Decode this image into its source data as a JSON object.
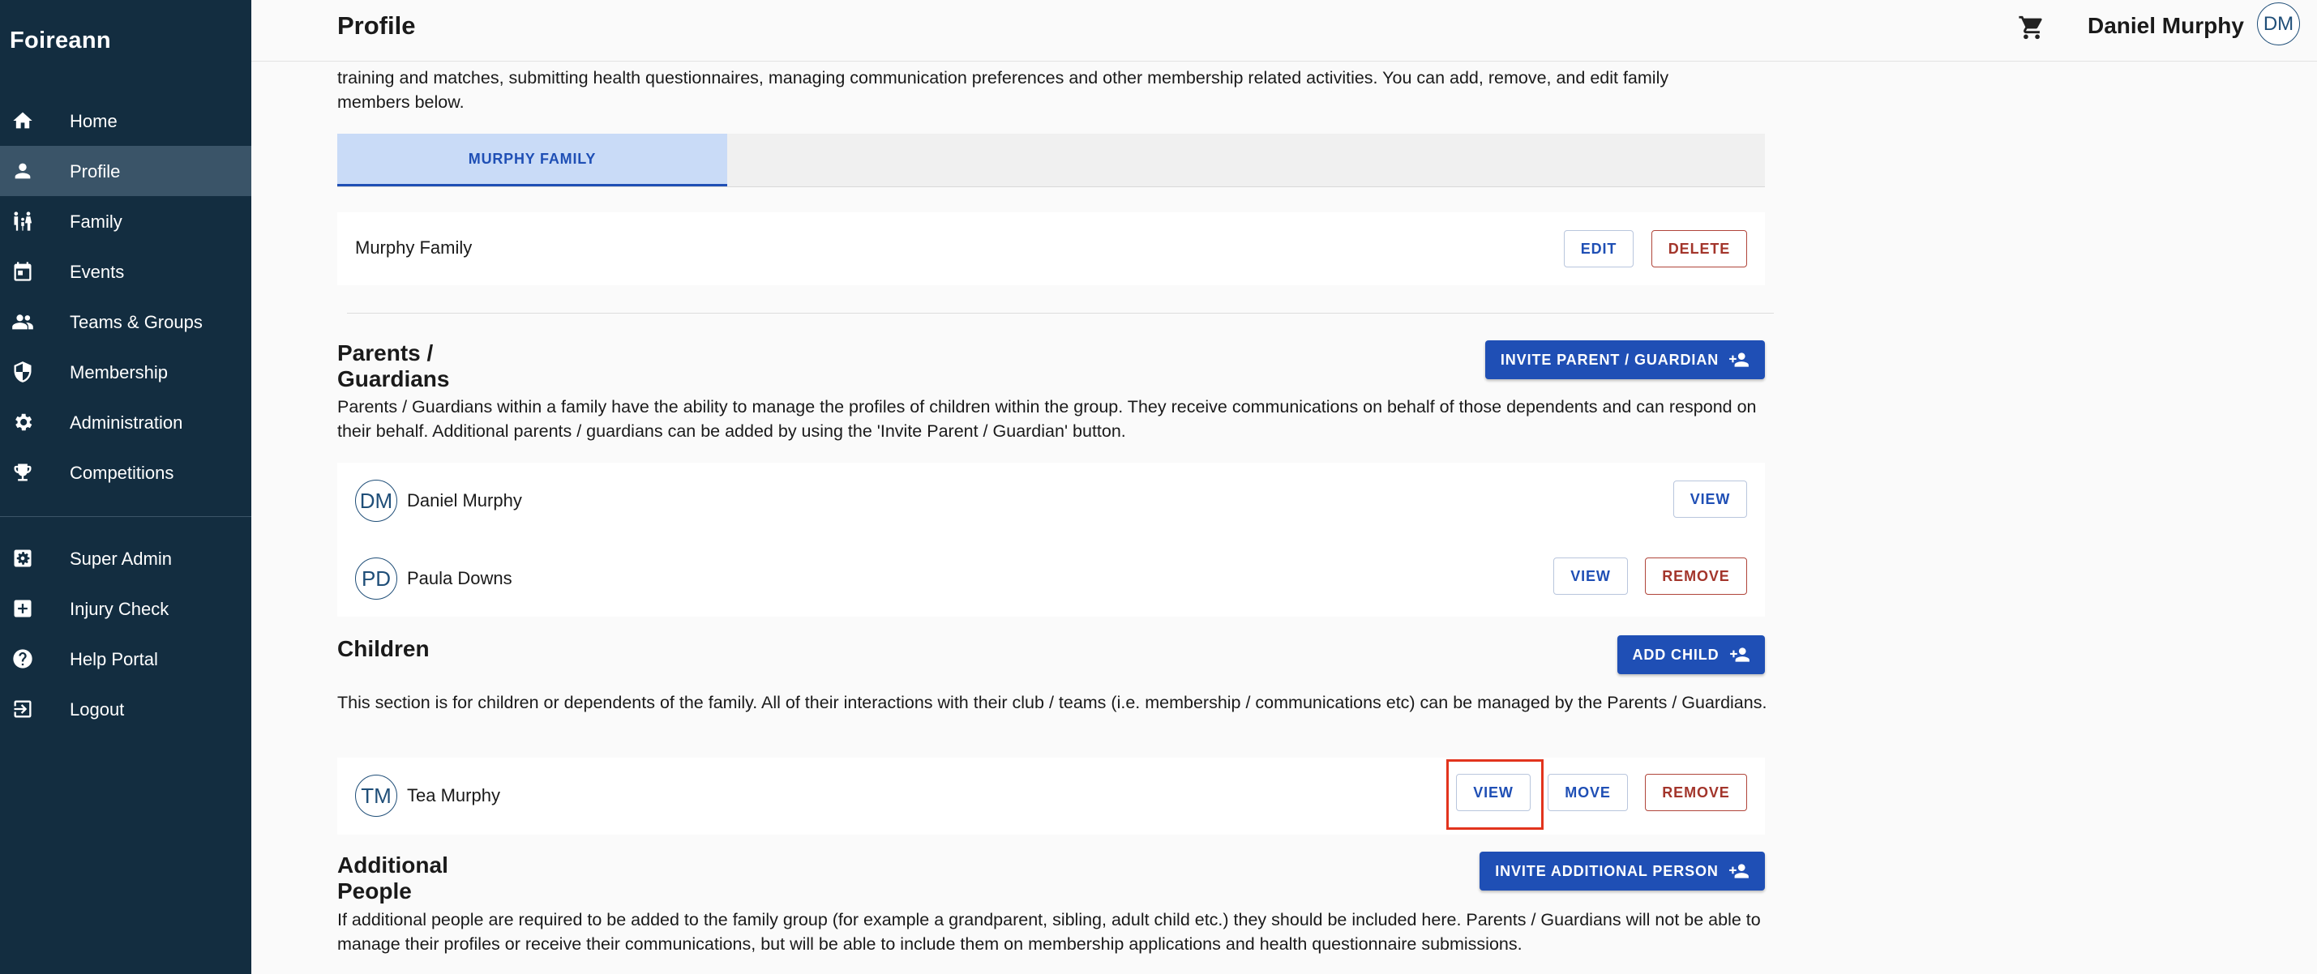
{
  "app": {
    "name": "Foireann"
  },
  "sidebar": {
    "items": [
      {
        "label": "Home",
        "icon": "home-icon"
      },
      {
        "label": "Profile",
        "icon": "person-icon",
        "active": true
      },
      {
        "label": "Family",
        "icon": "family-icon"
      },
      {
        "label": "Events",
        "icon": "calendar-icon"
      },
      {
        "label": "Teams & Groups",
        "icon": "group-icon"
      },
      {
        "label": "Membership",
        "icon": "shield-icon"
      },
      {
        "label": "Administration",
        "icon": "gear-icon"
      },
      {
        "label": "Competitions",
        "icon": "trophy-icon"
      },
      {
        "label": "Super Admin",
        "icon": "admin-panel-icon"
      },
      {
        "label": "Injury Check",
        "icon": "medical-cross-icon"
      },
      {
        "label": "Help Portal",
        "icon": "help-icon"
      },
      {
        "label": "Logout",
        "icon": "logout-icon"
      }
    ]
  },
  "header": {
    "title": "Profile",
    "user_name": "Daniel Murphy",
    "user_initials": "DM"
  },
  "intro": {
    "line1": "training and matches, submitting health questionnaires, managing communication preferences and other membership related activities. You can add, remove, and edit family",
    "line2": "members below."
  },
  "tabs": [
    {
      "label": "MURPHY FAMILY",
      "active": true
    }
  ],
  "family": {
    "name": "Murphy Family",
    "edit_label": "EDIT",
    "delete_label": "DELETE"
  },
  "guardians": {
    "title": "Parents / Guardians",
    "invite_label": "INVITE PARENT / GUARDIAN",
    "description": "Parents / Guardians within a family have the ability to manage the profiles of children within the group. They receive communications on behalf of those dependents and can respond on their behalf. Additional parents / guardians can be added by using the 'Invite Parent / Guardian' button.",
    "members": [
      {
        "initials": "DM",
        "name": "Daniel Murphy",
        "view_label": "VIEW"
      },
      {
        "initials": "PD",
        "name": "Paula Downs",
        "view_label": "VIEW",
        "remove_label": "REMOVE"
      }
    ]
  },
  "children": {
    "title": "Children",
    "add_label": "ADD CHILD",
    "description": "This section is for children or dependents of the family. All of their interactions with their club / teams (i.e. membership / communications etc) can be managed by the Parents / Guardians.",
    "members": [
      {
        "initials": "TM",
        "name": "Tea Murphy",
        "view_label": "VIEW",
        "move_label": "MOVE",
        "remove_label": "REMOVE"
      }
    ]
  },
  "additional": {
    "title": "Additional People",
    "invite_label": "INVITE ADDITIONAL PERSON",
    "description": "If additional people are required to be added to the family group (for example a grandparent, sibling, adult child etc.) they should be included here. Parents / Guardians will not be able to manage their profiles or receive their communications, but will be able to include them on membership applications and health questionnaire submissions."
  },
  "colors": {
    "sidebar_bg": "#132d40",
    "sidebar_active": "#3a5468",
    "primary": "#1f4fb5",
    "danger": "#a3352b",
    "highlight": "#e2341d"
  }
}
